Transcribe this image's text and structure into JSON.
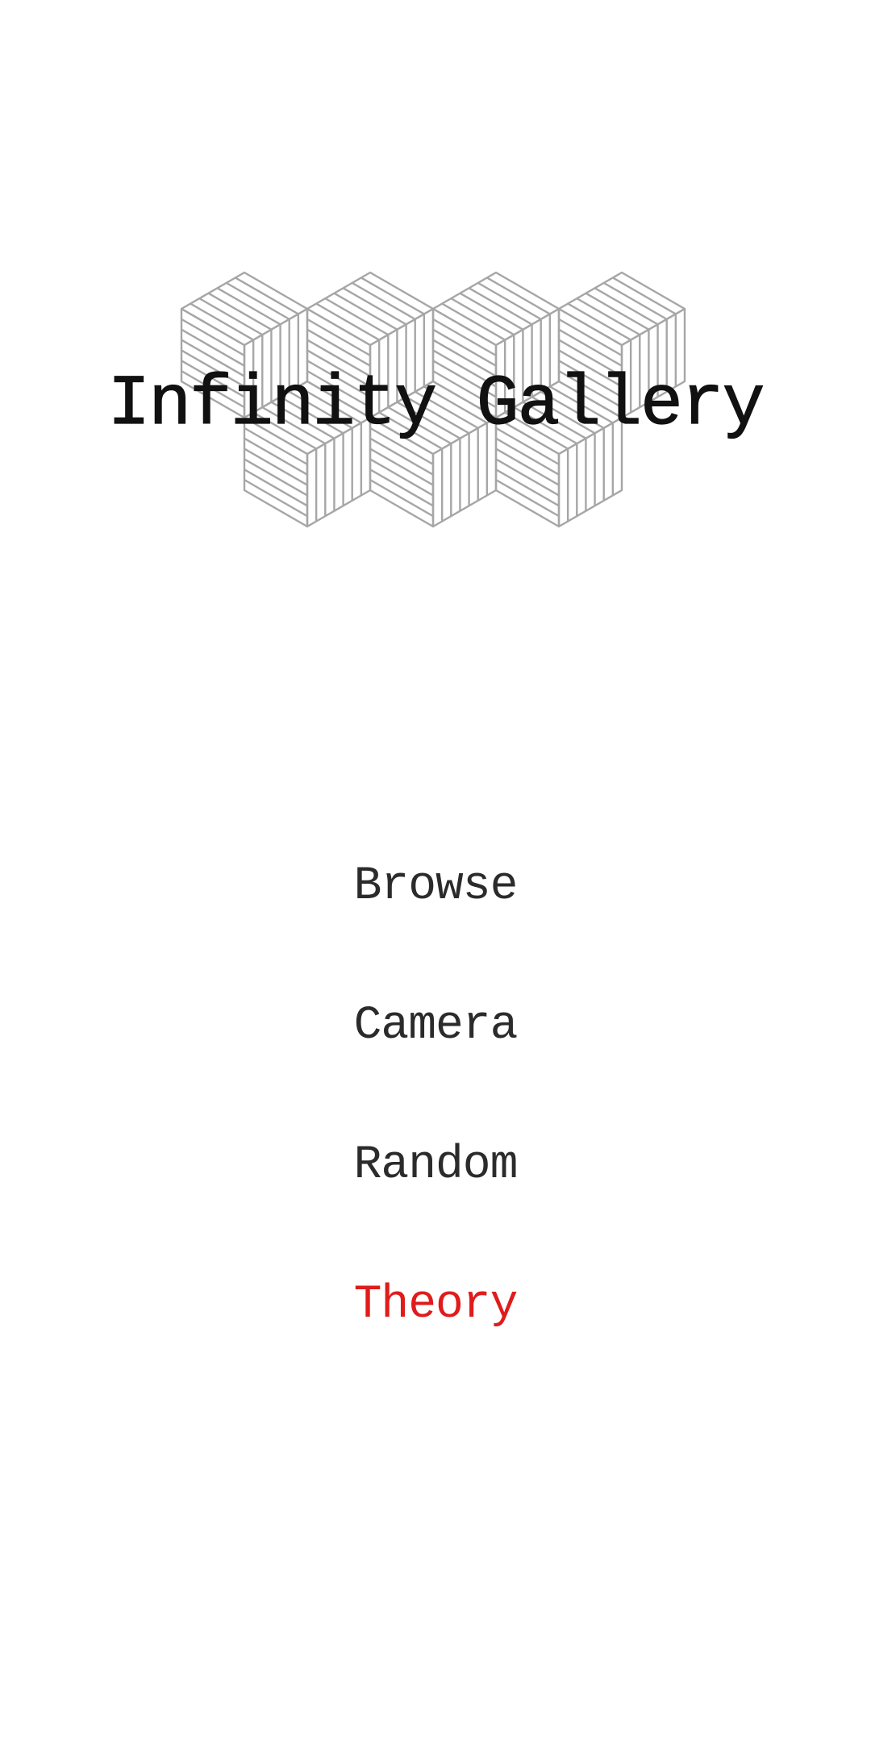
{
  "app": {
    "title": "Infinity Gallery"
  },
  "logo": {
    "icon": "isometric-cubes-icon",
    "color": "#a6a6a6"
  },
  "menu": {
    "items": [
      {
        "label": "Browse",
        "active": false
      },
      {
        "label": "Camera",
        "active": false
      },
      {
        "label": "Random",
        "active": false
      },
      {
        "label": "Theory",
        "active": true
      }
    ]
  },
  "colors": {
    "text": "#2b2b2b",
    "title": "#111111",
    "accent": "#e01b1b",
    "background": "#ffffff"
  }
}
